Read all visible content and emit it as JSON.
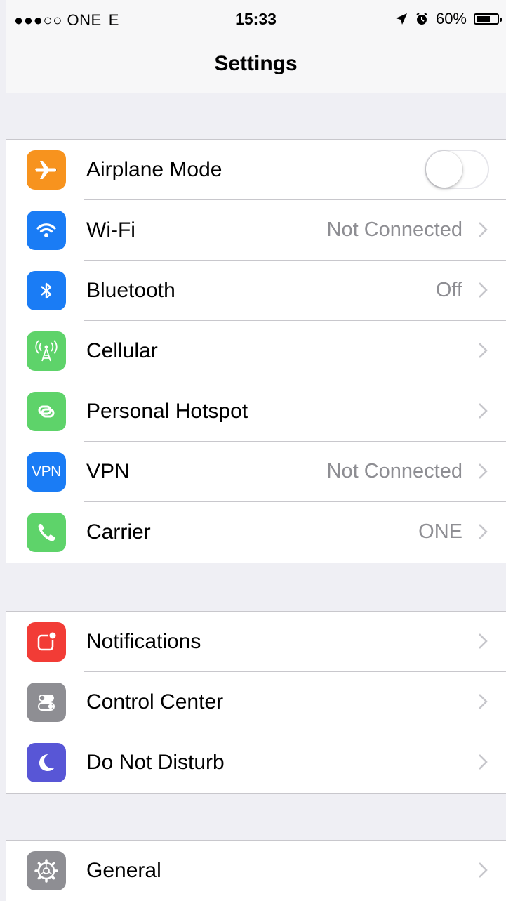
{
  "status": {
    "carrier": "●●●○○ ONE",
    "network": "E",
    "time": "15:33",
    "battery": "60%",
    "battery_level": 0.6
  },
  "nav": {
    "title": "Settings"
  },
  "colors": {
    "airplane": "#f7931e",
    "wifi": "#1a7cf5",
    "bluetooth": "#1a7cf5",
    "cellular": "#5ed36a",
    "hotspot": "#5ed36a",
    "vpn": "#1a7cf5",
    "carrier": "#5ed36a",
    "notifications": "#f23c36",
    "control_center": "#8e8e93",
    "do_not_disturb": "#5856d6",
    "general": "#8e8e93"
  },
  "sections": [
    {
      "rows": [
        {
          "label": "Airplane Mode",
          "icon": "airplane-icon",
          "toggle": false
        },
        {
          "label": "Wi-Fi",
          "icon": "wifi-icon",
          "value": "Not Connected"
        },
        {
          "label": "Bluetooth",
          "icon": "bluetooth-icon",
          "value": "Off"
        },
        {
          "label": "Cellular",
          "icon": "cellular-antenna-icon",
          "value": ""
        },
        {
          "label": "Personal Hotspot",
          "icon": "hotspot-icon",
          "value": ""
        },
        {
          "label": "VPN",
          "icon": "vpn-icon",
          "icon_text": "VPN",
          "value": "Not Connected"
        },
        {
          "label": "Carrier",
          "icon": "phone-icon",
          "value": "ONE"
        }
      ]
    },
    {
      "rows": [
        {
          "label": "Notifications",
          "icon": "notifications-icon"
        },
        {
          "label": "Control Center",
          "icon": "control-center-icon"
        },
        {
          "label": "Do Not Disturb",
          "icon": "moon-icon"
        }
      ]
    },
    {
      "rows": [
        {
          "label": "General",
          "icon": "gear-icon"
        }
      ]
    }
  ]
}
